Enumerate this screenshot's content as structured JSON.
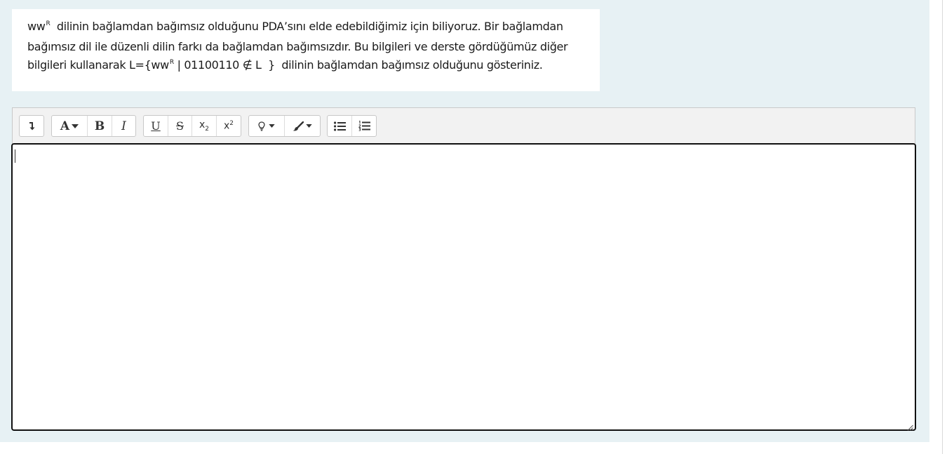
{
  "question": {
    "line1": {
      "pre": "ww",
      "sup": "R",
      "post": "  dilinin bağlamdan bağımsız olduğunu PDA’sını elde edebildiğimiz için biliyoruz. Bir bağlamdan"
    },
    "line2": "bağımsız dil ile düzenli dilin farkı da bağlamdan bağımsızdır. Bu bilgileri ve derste gördüğümüz diğer",
    "line3": {
      "pre": "bilgileri kullanarak L={ww",
      "sup": "R",
      "post": " | 01100110 ∉ L  }  dilinin bağlamdan bağımsız olduğunu gösteriniz."
    }
  },
  "toolbar": {
    "groups": [
      {
        "name": "collapse",
        "buttons": [
          {
            "name": "collapse-toolbar-button",
            "icon": "collapse-arrow-icon"
          }
        ]
      },
      {
        "name": "format",
        "buttons": [
          {
            "name": "font-style-button",
            "icon": "font-a-caret-icon",
            "label": "A"
          },
          {
            "name": "bold-button",
            "icon": "bold-icon",
            "label": "B"
          },
          {
            "name": "italic-button",
            "icon": "italic-icon",
            "label": "I"
          }
        ]
      },
      {
        "name": "script",
        "buttons": [
          {
            "name": "underline-button",
            "icon": "underline-icon",
            "label": "U"
          },
          {
            "name": "strikethrough-button",
            "icon": "strikethrough-icon",
            "label": "S"
          },
          {
            "name": "subscript-button",
            "icon": "subscript-icon",
            "label": "x",
            "sub": "2"
          },
          {
            "name": "superscript-button",
            "icon": "superscript-icon",
            "label": "x",
            "sup": "2"
          }
        ]
      },
      {
        "name": "color",
        "buttons": [
          {
            "name": "highlight-button",
            "icon": "lightbulb-caret-icon"
          },
          {
            "name": "text-color-button",
            "icon": "brush-caret-icon"
          }
        ]
      },
      {
        "name": "lists",
        "buttons": [
          {
            "name": "unordered-list-button",
            "icon": "bullet-list-icon"
          },
          {
            "name": "ordered-list-button",
            "icon": "numbered-list-icon"
          }
        ]
      }
    ]
  },
  "editor": {
    "value": "",
    "resize_handle_icon": "resize-grip-icon"
  },
  "colors": {
    "panel_background": "#e7f1f4",
    "editor_border": "#111111",
    "toolbar_background": "#f2f2f2"
  }
}
